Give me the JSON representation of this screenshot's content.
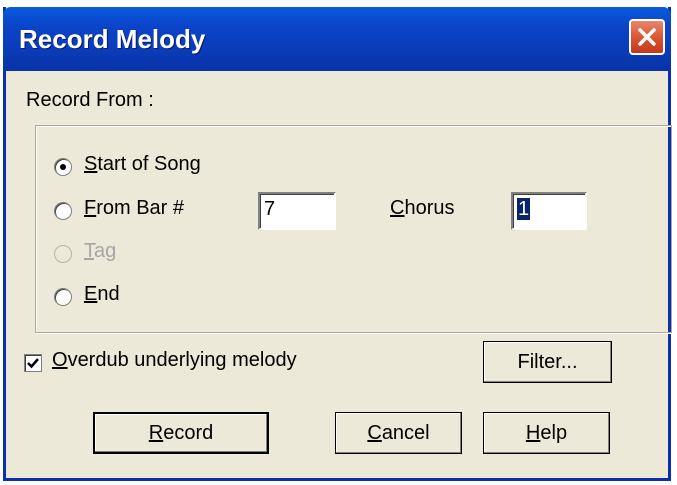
{
  "dialog": {
    "title": "Record Melody",
    "record_from_label": "Record From :",
    "options": {
      "start_of_song": "Start of Song",
      "from_bar": "From Bar #",
      "tag": "Tag",
      "end": "End",
      "selected": "start_of_song"
    },
    "from_bar_value": "7",
    "chorus_label": "Chorus",
    "chorus_value": "1",
    "overdub_label": "Overdub underlying melody",
    "overdub_checked": true,
    "buttons": {
      "filter": "Filter...",
      "record": "Record",
      "cancel": "Cancel",
      "help": "Help"
    },
    "colors": {
      "titlebar": "#0a44c9",
      "close_button": "#d6502e",
      "dialog_bg": "#ece9d8"
    }
  }
}
